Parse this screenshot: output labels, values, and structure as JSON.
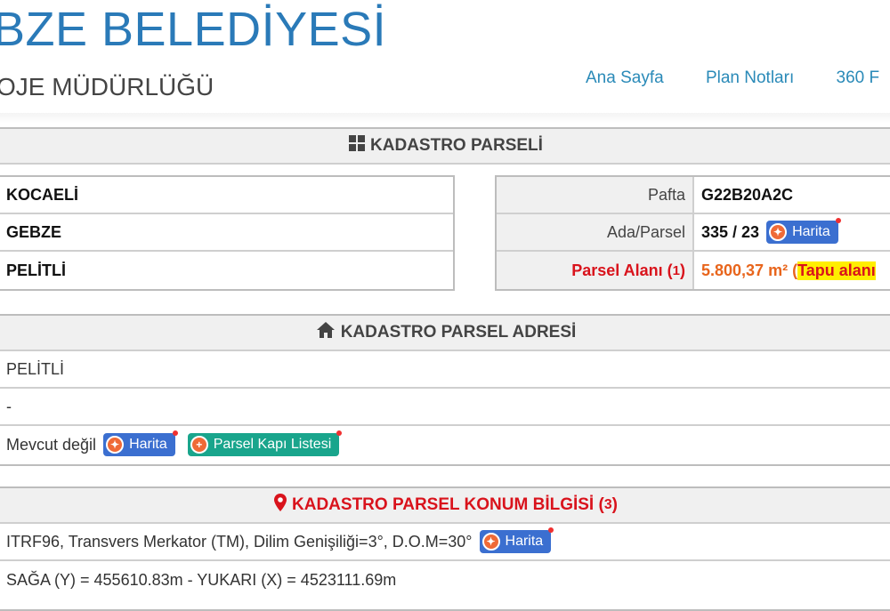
{
  "header": {
    "brand": "BZE BELEDİYESİ",
    "subtitle": "OJE MÜDÜRLÜĞÜ",
    "nav": [
      "Ana Sayfa",
      "Plan Notları",
      "360 F"
    ]
  },
  "kadastro": {
    "title": "KADASTRO PARSELİ",
    "left_values": [
      "KOCAELİ",
      "GEBZE",
      "PELİTLİ"
    ],
    "pafta_label": "Pafta",
    "pafta_value": "G22B20A2C",
    "ada_label": "Ada/Parsel",
    "ada_value": "335 / 23",
    "harita_label": "Harita",
    "alan_label": "Parsel Alanı (",
    "alan_sup": "1",
    "alan_close": ")",
    "alan_value": "5.800,37 m² (",
    "alan_note": "Tapu alanı"
  },
  "adres": {
    "title": "KADASTRO PARSEL ADRESİ",
    "line1": "PELİTLİ",
    "line2": "-",
    "line3": "Mevcut değil",
    "harita_label": "Harita",
    "kapi_label": "Parsel Kapı Listesi"
  },
  "konum": {
    "title": "KADASTRO PARSEL KONUM BİLGİSİ (",
    "title_sup": "3",
    "title_close": ")",
    "projection": "ITRF96, Transvers Merkator (TM), Dilim Genişiliği=3°, D.O.M=30°",
    "harita_label": "Harita",
    "coords": "SAĞA (Y) = 455610.83m - YUKARI (X) = 4523111.69m"
  },
  "colors": {
    "brand": "#2a7ab8",
    "nav": "#2a8ab8",
    "alert_red": "#d9131c",
    "area_orange": "#e8651c",
    "highlight_yellow": "#ffee00",
    "button_blue": "#3b6fd0",
    "button_teal": "#19a58c"
  }
}
